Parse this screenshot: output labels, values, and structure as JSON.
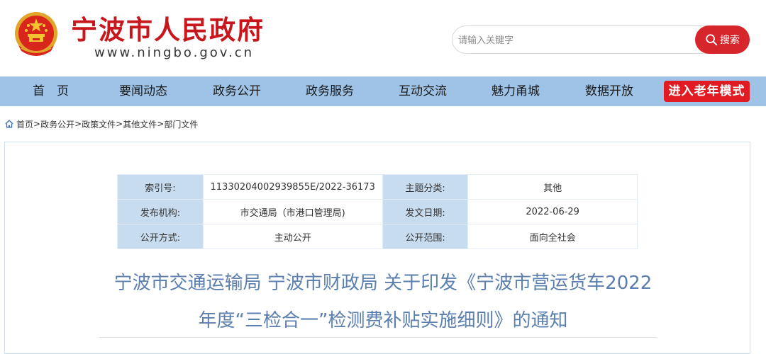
{
  "header": {
    "site_title": "宁波市人民政府",
    "site_url": "www.ningbo.gov.cn",
    "emblem_icon": "national-emblem-icon",
    "search": {
      "placeholder": "请输入关键字",
      "button_label": "搜索",
      "icon": "search-icon"
    }
  },
  "nav": {
    "items": [
      {
        "label": "首　页"
      },
      {
        "label": "要闻动态"
      },
      {
        "label": "政务公开"
      },
      {
        "label": "政务服务"
      },
      {
        "label": "互动交流"
      },
      {
        "label": "魅力甬城"
      },
      {
        "label": "数据开放"
      }
    ],
    "elder_mode_label": "进入老年模式"
  },
  "breadcrumb": {
    "icon": "home-icon",
    "items": [
      "首页",
      "政务公开",
      "政策文件",
      "其他文件",
      "部门文件"
    ],
    "separator": ">"
  },
  "meta": {
    "rows": [
      {
        "label1": "索引号:",
        "value1": "11330204002939855E/2022-36173",
        "label2": "主题分类:",
        "value2": "其他"
      },
      {
        "label1": "发布机构:",
        "value1": "市交通局（市港口管理局)",
        "label2": "发文日期:",
        "value2": "2022-06-29"
      },
      {
        "label1": "公开方式:",
        "value1": "主动公开",
        "label2": "公开范围:",
        "value2": "面向全社会"
      }
    ]
  },
  "document": {
    "title_line1": "宁波市交通运输局 宁波市财政局 关于印发《宁波市营运货车2022",
    "title_line2": "年度“三检合一”检测费补贴实施细则》的通知"
  },
  "colors": {
    "brand_red": "#c8161d",
    "nav_bg": "#9fc3e6",
    "elder_btn": "#e21b22",
    "title_blue": "#5b7fae",
    "label_bg": "#c7dcee"
  }
}
